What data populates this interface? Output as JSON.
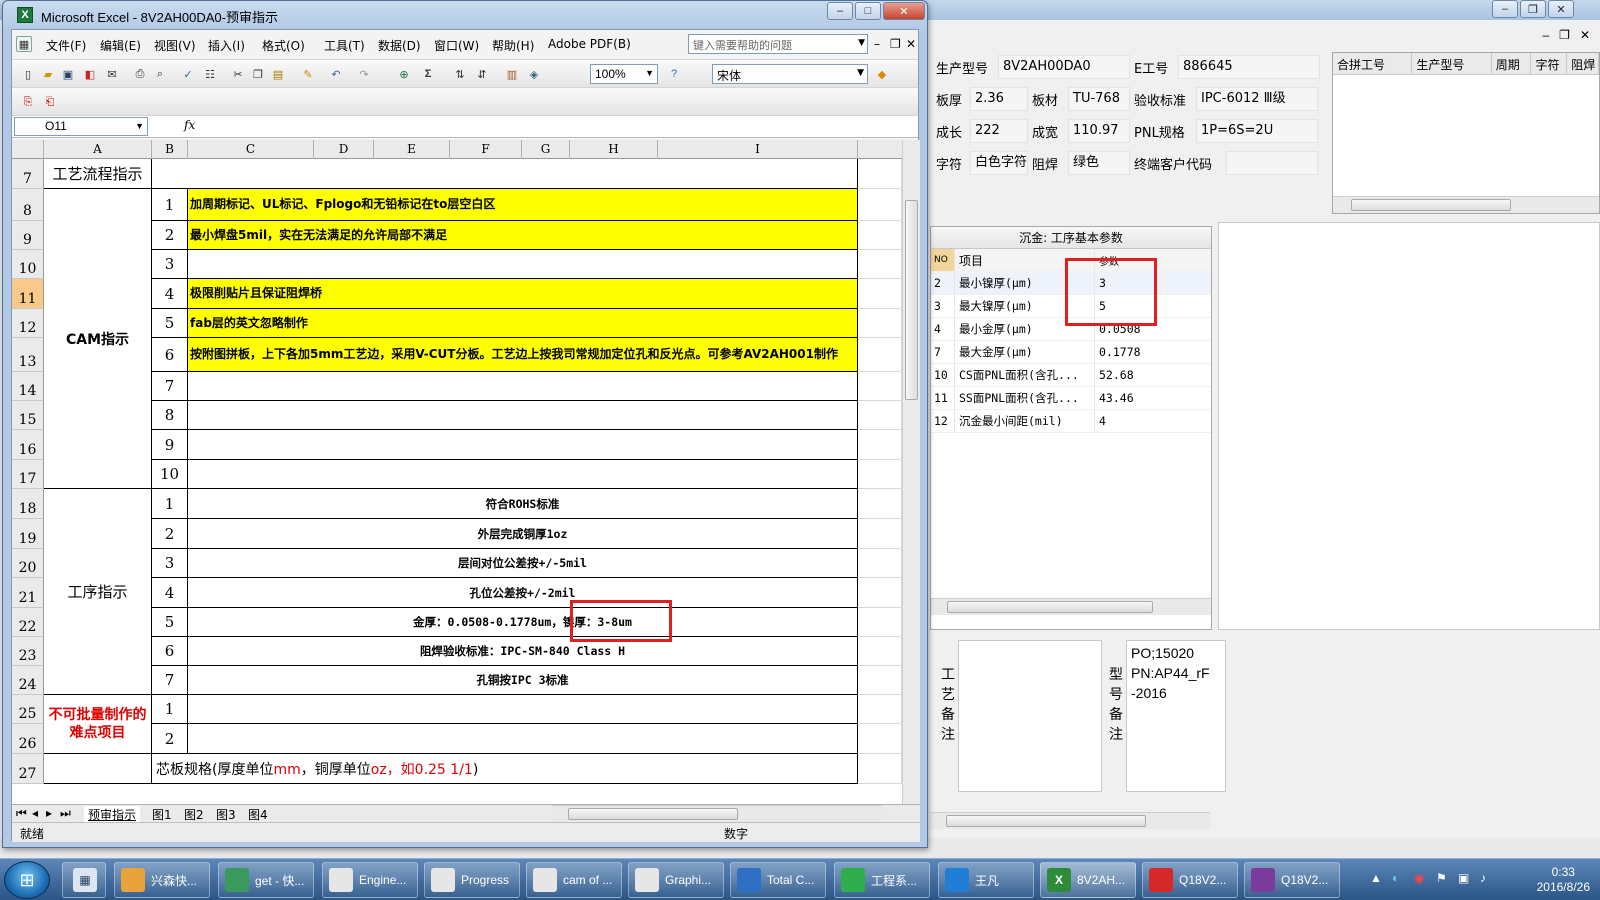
{
  "excel": {
    "title": "Microsoft Excel - 8V2AH00DA0-预审指示",
    "icon_name": "excel-icon",
    "menu": [
      "文件(F)",
      "编辑(E)",
      "视图(V)",
      "插入(I)",
      "格式(O)",
      "工具(T)",
      "数据(D)",
      "窗口(W)",
      "帮助(H)",
      "Adobe PDF(B)"
    ],
    "help_placeholder": "键入需要帮助的问题",
    "zoom": "100%",
    "font": "宋体",
    "namebox": "O11",
    "fx": "fx",
    "columns": [
      "A",
      "B",
      "C",
      "D",
      "E",
      "F",
      "G",
      "H",
      "I"
    ],
    "rows": [
      "7",
      "8",
      "9",
      "10",
      "11",
      "12",
      "13",
      "14",
      "15",
      "16",
      "17",
      "18",
      "19",
      "20",
      "21",
      "22",
      "23",
      "24",
      "25",
      "26",
      "27"
    ],
    "selected_row": "11",
    "header_cell": "工艺流程指示",
    "cam": {
      "group": "CAM指示",
      "nums": [
        "1",
        "2",
        "3",
        "4",
        "5",
        "6",
        "7",
        "8",
        "9",
        "10"
      ],
      "items": [
        "加周期标记、UL标记、Fplogo和无铅标记在to层空白区",
        "最小焊盘5mil，实在无法满足的允许局部不满足",
        "",
        "极限削贴片且保证阻焊桥",
        "fab层的英文忽略制作",
        "按附图拼板，上下各加5mm工艺边，采用V-CUT分板。工艺边上按我司常规加定位孔和反光点。可参考AV2AH001制作",
        "",
        "",
        "",
        ""
      ]
    },
    "process": {
      "group": "工序指示",
      "nums": [
        "1",
        "2",
        "3",
        "4",
        "5",
        "6",
        "7"
      ],
      "items": [
        "符合ROHS标准",
        "外层完成铜厚1oz",
        "层间对位公差按+/-5mil",
        "孔位公差按+/-2mil",
        "金厚：0.0508-0.1778um，镍厚：3-8um",
        "阻焊验收标准：IPC-SM-840 Class H",
        "孔铜按IPC 3标准"
      ]
    },
    "difficult": {
      "group": "不可批量制作的难点项目",
      "nums": [
        "1",
        "2"
      ]
    },
    "core_spec": {
      "prefix": "芯板规格(厚度单位",
      "unit1": "mm",
      "mid": "，铜厚单位",
      "unit2": "oz，如0.25 1/1",
      "suffix": ")"
    },
    "sheet_tabs": [
      "预审指示",
      "图1",
      "图2",
      "图3",
      "图4"
    ],
    "status_left": "就绪",
    "status_right": "数字"
  },
  "background_app": {
    "info": {
      "model_label": "生产型号",
      "model": "8V2AH00DA0",
      "eno_label": "E工号",
      "eno": "886645",
      "thick_label": "板厚",
      "thick": "2.36",
      "material_label": "板材",
      "material": "TU-768",
      "accept_label": "验收标准",
      "accept": "IPC-6012 Ⅲ级",
      "len_label": "成长",
      "len": "222",
      "width_label": "成宽",
      "width": "110.97",
      "pnl_label": "PNL规格",
      "pnl": "1P=6S=2U",
      "char_label": "字符",
      "char": "白色字符",
      "mask_label": "阻焊",
      "mask": "绿色",
      "customer_label": "终端客户代码",
      "customer": ""
    },
    "merge_grid_headers": [
      "合拼工号",
      "生产型号",
      "周期",
      "字符",
      "阻焊"
    ],
    "param_panel": {
      "title": "沉金: 工序基本参数",
      "headers": [
        "NO",
        "项目",
        "参数"
      ],
      "rows": [
        {
          "no": "2",
          "item": "最小镍厚(μm)",
          "val": "3"
        },
        {
          "no": "3",
          "item": "最大镍厚(μm)",
          "val": "5"
        },
        {
          "no": "4",
          "item": "最小金厚(μm)",
          "val": "0.0508"
        },
        {
          "no": "7",
          "item": "最大金厚(μm)",
          "val": "0.1778"
        },
        {
          "no": "10",
          "item": "CS面PNL面积(含孔...",
          "val": "52.68"
        },
        {
          "no": "11",
          "item": "SS面PNL面积(含孔...",
          "val": "43.46"
        },
        {
          "no": "12",
          "item": "沉金最小间距(mil)",
          "val": "4"
        }
      ]
    },
    "remarks": {
      "process_label": [
        "工",
        "艺",
        "备",
        "注"
      ],
      "model_label": [
        "型",
        "号",
        "备",
        "注"
      ],
      "model_remark": "PO;15020\nPN:AP44_rF\n-2016"
    }
  },
  "taskbar": {
    "tasks": [
      {
        "label": "兴森快...",
        "icon": "folder-icon",
        "color": "#e8a33a"
      },
      {
        "label": "get - 快...",
        "icon": "browser-icon",
        "color": "#3a9a5e"
      },
      {
        "label": "Engine...",
        "icon": "app-icon",
        "color": "#e6e6e6"
      },
      {
        "label": "Progress",
        "icon": "app-icon",
        "color": "#e6e6e6"
      },
      {
        "label": "cam of ...",
        "icon": "app-icon",
        "color": "#e6e6e6"
      },
      {
        "label": "Graphi...",
        "icon": "app-icon",
        "color": "#e6e6e6"
      },
      {
        "label": "Total C...",
        "icon": "disk-icon",
        "color": "#2d6fc4"
      },
      {
        "label": "工程系...",
        "icon": "app-icon",
        "color": "#2fae4b"
      },
      {
        "label": "王凡",
        "icon": "chat-icon",
        "color": "#1f7fd6"
      },
      {
        "label": "8V2AH...",
        "icon": "excel-icon",
        "color": "#2e8b3a"
      },
      {
        "label": "Q18V2...",
        "icon": "app-icon",
        "color": "#d62a2a"
      },
      {
        "label": "Q18V2...",
        "icon": "archive-icon",
        "color": "#7c3b9a"
      }
    ],
    "time": "0:33",
    "date": "2016/8/26"
  }
}
